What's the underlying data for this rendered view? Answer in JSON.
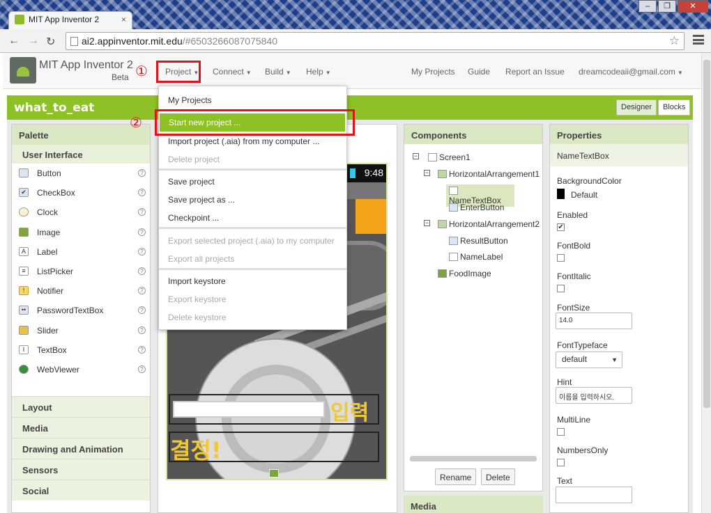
{
  "browser": {
    "tab_title": "MIT App Inventor 2",
    "tab_close": "×",
    "window_controls": [
      "–",
      "❐",
      "✕"
    ],
    "url_host": "ai2.appinventor.mit.edu",
    "url_hash": "/#6503266087075840"
  },
  "app": {
    "name": "MIT App Inventor 2",
    "beta": "Beta",
    "menus": [
      "Project",
      "Connect",
      "Build",
      "Help"
    ],
    "right_links": [
      "My Projects",
      "Guide",
      "Report an Issue",
      "dreamcodeaii@gmail.com"
    ],
    "annotation_1": "①",
    "annotation_2": "②"
  },
  "project": {
    "title": "what_to_eat",
    "designer_label": "Designer",
    "blocks_label": "Blocks"
  },
  "project_menu": {
    "items": [
      {
        "label": "My Projects",
        "disabled": false
      },
      {
        "label": "Start new project ...",
        "disabled": false,
        "highlighted": true
      },
      {
        "label": "Import project (.aia) from my computer ...",
        "disabled": false
      },
      {
        "label": "Delete project",
        "disabled": true
      },
      {
        "label": "Save project",
        "disabled": false
      },
      {
        "label": "Save project as ...",
        "disabled": false
      },
      {
        "label": "Checkpoint ...",
        "disabled": false
      },
      {
        "label": "Export selected project (.aia) to my computer",
        "disabled": true
      },
      {
        "label": "Export all projects",
        "disabled": true
      },
      {
        "label": "Import keystore",
        "disabled": false
      },
      {
        "label": "Export keystore",
        "disabled": true
      },
      {
        "label": "Delete keystore",
        "disabled": true
      }
    ]
  },
  "palette": {
    "title": "Palette",
    "section": "User Interface",
    "items": [
      "Button",
      "CheckBox",
      "Clock",
      "Image",
      "Label",
      "ListPicker",
      "Notifier",
      "PasswordTextBox",
      "Slider",
      "TextBox",
      "WebViewer"
    ],
    "categories": [
      "Layout",
      "Media",
      "Drawing and Animation",
      "Sensors",
      "Social"
    ],
    "help_glyph": "?"
  },
  "viewer": {
    "time": "9:48",
    "enter_button": "입력",
    "result_button": "결정!"
  },
  "components": {
    "title": "Components",
    "tree": [
      "Screen1",
      "HorizontalArrangement1",
      "NameTextBox",
      "EnterButton",
      "HorizontalArrangement2",
      "ResultButton",
      "NameLabel",
      "FoodImage"
    ],
    "rename_label": "Rename",
    "delete_label": "Delete",
    "media_title": "Media"
  },
  "properties": {
    "title": "Properties",
    "component": "NameTextBox",
    "background_color_label": "BackgroundColor",
    "background_color_value": "Default",
    "enabled_label": "Enabled",
    "fontbold_label": "FontBold",
    "fontitalic_label": "FontItalic",
    "fontsize_label": "FontSize",
    "fontsize_value": "14.0",
    "fonttypeface_label": "FontTypeface",
    "fonttypeface_value": "default",
    "hint_label": "Hint",
    "hint_value": "이름을 입력하시오.",
    "multiline_label": "MultiLine",
    "numbersonly_label": "NumbersOnly",
    "text_label": "Text",
    "text_value": "",
    "enabled": true,
    "fontbold": false,
    "fontitalic": false,
    "multiline": false,
    "numbersonly": false
  },
  "colors": {
    "accent_green": "#8dc126",
    "annotation_red": "#e0121b"
  }
}
